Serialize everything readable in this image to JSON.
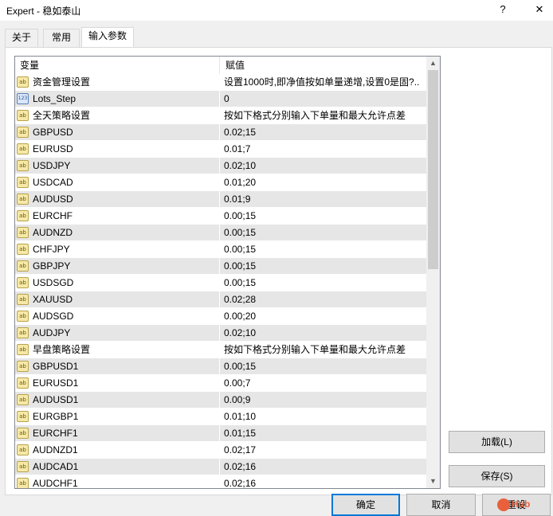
{
  "window": {
    "title": "Expert - 稳如泰山",
    "help": "?",
    "close": "✕"
  },
  "tabs": [
    {
      "label": "关于"
    },
    {
      "label": "常用"
    },
    {
      "label": "输入参数"
    }
  ],
  "grid": {
    "headers": {
      "variable": "变量",
      "value": "赋值"
    },
    "rows": [
      {
        "type": "ab",
        "name": "资金管理设置",
        "value": "设置1000时,即净值按如单量递增,设置0是固?.."
      },
      {
        "type": "123",
        "name": "Lots_Step",
        "value": "0"
      },
      {
        "type": "ab",
        "name": "全天策略设置",
        "value": "按如下格式分别输入下单量和最大允许点差"
      },
      {
        "type": "ab",
        "name": "GBPUSD",
        "value": "0.02;15"
      },
      {
        "type": "ab",
        "name": "EURUSD",
        "value": "0.01;7"
      },
      {
        "type": "ab",
        "name": "USDJPY",
        "value": "0.02;10"
      },
      {
        "type": "ab",
        "name": "USDCAD",
        "value": "0.01;20"
      },
      {
        "type": "ab",
        "name": "AUDUSD",
        "value": "0.01;9"
      },
      {
        "type": "ab",
        "name": "EURCHF",
        "value": "0.00;15"
      },
      {
        "type": "ab",
        "name": "AUDNZD",
        "value": "0.00;15"
      },
      {
        "type": "ab",
        "name": "CHFJPY",
        "value": "0.00;15"
      },
      {
        "type": "ab",
        "name": "GBPJPY",
        "value": "0.00;15"
      },
      {
        "type": "ab",
        "name": "USDSGD",
        "value": "0.00;15"
      },
      {
        "type": "ab",
        "name": "XAUUSD",
        "value": "0.02;28"
      },
      {
        "type": "ab",
        "name": "AUDSGD",
        "value": "0.00;20"
      },
      {
        "type": "ab",
        "name": "AUDJPY",
        "value": "0.02;10"
      },
      {
        "type": "ab",
        "name": "早盘策略设置",
        "value": "按如下格式分别输入下单量和最大允许点差"
      },
      {
        "type": "ab",
        "name": "GBPUSD1",
        "value": "0.00;15"
      },
      {
        "type": "ab",
        "name": "EURUSD1",
        "value": "0.00;7"
      },
      {
        "type": "ab",
        "name": "AUDUSD1",
        "value": "0.00;9"
      },
      {
        "type": "ab",
        "name": "EURGBP1",
        "value": "0.01;10"
      },
      {
        "type": "ab",
        "name": "EURCHF1",
        "value": "0.01;15"
      },
      {
        "type": "ab",
        "name": "AUDNZD1",
        "value": "0.02;17"
      },
      {
        "type": "ab",
        "name": "AUDCAD1",
        "value": "0.02;16"
      },
      {
        "type": "ab",
        "name": "AUDCHF1",
        "value": "0.02;16"
      }
    ]
  },
  "buttons": {
    "load": "加载(L)",
    "save": "保存(S)",
    "ok": "确定",
    "cancel": "取消",
    "reset": "重设"
  },
  "watermark": "Hub",
  "icons": {
    "string": "ab",
    "integer": "123",
    "scroll_up": "▲",
    "scroll_down": "▼"
  }
}
